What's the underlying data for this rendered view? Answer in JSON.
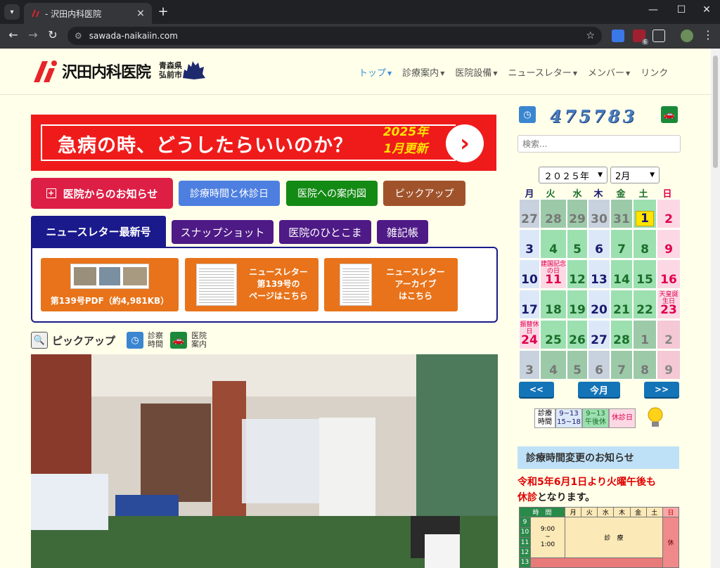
{
  "browser": {
    "tab_title": "- 沢田内科医院",
    "url": "sawada-naikaiin.com",
    "ext_badge": "6"
  },
  "header": {
    "logo_text": "沢田内科医院",
    "logo_pref_line1": "青森県",
    "logo_pref_line2": "弘前市",
    "nav": [
      {
        "label": "トップ"
      },
      {
        "label": "診療案内"
      },
      {
        "label": "医院設備"
      },
      {
        "label": "ニュースレター"
      },
      {
        "label": "メンバー"
      },
      {
        "label": "リンク"
      }
    ]
  },
  "banner": {
    "text": "急病の時、どうしたらいいのか？",
    "update_line1": "2025年",
    "update_line2": "1月更新",
    "arrow": "›"
  },
  "buttons_row1": {
    "news": "医院からのお知らせ",
    "hours": "診療時間と休診日",
    "map": "医院への案内図",
    "pickup": "ピックアップ"
  },
  "tabs_row2": {
    "newsletter": "ニュースレター最新号",
    "snapshot": "スナップショット",
    "hitokoma": "医院のひとこま",
    "zakki": "雑記帳"
  },
  "newsletter": {
    "pdf_label": "第139号PDF（約4,981KB）",
    "page_line1": "ニュースレター",
    "page_line2": "第139号の",
    "page_line3": "ページはこちら",
    "archive_line1": "ニュースレター",
    "archive_line2": "アーカイブ",
    "archive_line3": "はこちら"
  },
  "pickup_bar": {
    "label": "ピックアップ",
    "hours_line1": "診察",
    "hours_line2": "時間",
    "map_line1": "医院",
    "map_line2": "案内"
  },
  "sidebar": {
    "counter": "475783",
    "search_placeholder": "検索...",
    "year": "２０２５年",
    "month": "2月",
    "weekdays": [
      "月",
      "火",
      "水",
      "木",
      "金",
      "土",
      "日"
    ],
    "prev": "<<",
    "today": "今月",
    "next": ">>",
    "legend": {
      "label_line1": "診療",
      "label_line2": "時間",
      "full_line1": "9~13",
      "full_line2": "15~18",
      "half_line1": "9~13",
      "half_line2": "午後休",
      "closed": "休診日"
    },
    "notice_title": "診療時間変更のお知らせ",
    "notice_red1": "令和5年6月1日より火曜午後も",
    "notice_red2": "休診",
    "notice_black": "となります。",
    "table": {
      "head": [
        "時　間",
        "月",
        "火",
        "水",
        "木",
        "金",
        "土",
        "日"
      ],
      "hours": [
        "9",
        "10",
        "11",
        "12",
        "13"
      ],
      "time_range_line1": "9:00",
      "time_range_line2": "~",
      "time_range_line3": "1:00",
      "shinryo": "診　療",
      "kyu": "休"
    }
  },
  "calendar": [
    {
      "d": "27",
      "t": "other"
    },
    {
      "d": "28",
      "t": "other-g"
    },
    {
      "d": "29",
      "t": "other-g"
    },
    {
      "d": "30",
      "t": "other"
    },
    {
      "d": "31",
      "t": "other-g"
    },
    {
      "d": "1",
      "t": "today"
    },
    {
      "d": "2",
      "t": "hol"
    },
    {
      "d": "3",
      "t": "full"
    },
    {
      "d": "4",
      "t": "half"
    },
    {
      "d": "5",
      "t": "half"
    },
    {
      "d": "6",
      "t": "full"
    },
    {
      "d": "7",
      "t": "half"
    },
    {
      "d": "8",
      "t": "half"
    },
    {
      "d": "9",
      "t": "hol"
    },
    {
      "d": "10",
      "t": "full"
    },
    {
      "d": "11",
      "t": "hol",
      "note": "建国記念の日"
    },
    {
      "d": "12",
      "t": "half"
    },
    {
      "d": "13",
      "t": "full"
    },
    {
      "d": "14",
      "t": "half"
    },
    {
      "d": "15",
      "t": "half"
    },
    {
      "d": "16",
      "t": "hol"
    },
    {
      "d": "17",
      "t": "full"
    },
    {
      "d": "18",
      "t": "half"
    },
    {
      "d": "19",
      "t": "half"
    },
    {
      "d": "20",
      "t": "full"
    },
    {
      "d": "21",
      "t": "half"
    },
    {
      "d": "22",
      "t": "half"
    },
    {
      "d": "23",
      "t": "hol",
      "note": "天皇誕生日"
    },
    {
      "d": "24",
      "t": "hol",
      "note": "振替休日"
    },
    {
      "d": "25",
      "t": "half"
    },
    {
      "d": "26",
      "t": "half"
    },
    {
      "d": "27",
      "t": "full"
    },
    {
      "d": "28",
      "t": "half"
    },
    {
      "d": "1",
      "t": "next-g"
    },
    {
      "d": "2",
      "t": "next-h"
    },
    {
      "d": "3",
      "t": "next"
    },
    {
      "d": "4",
      "t": "next-g"
    },
    {
      "d": "5",
      "t": "next-g"
    },
    {
      "d": "6",
      "t": "next"
    },
    {
      "d": "7",
      "t": "next-g"
    },
    {
      "d": "8",
      "t": "next-g"
    },
    {
      "d": "9",
      "t": "next-h"
    }
  ]
}
